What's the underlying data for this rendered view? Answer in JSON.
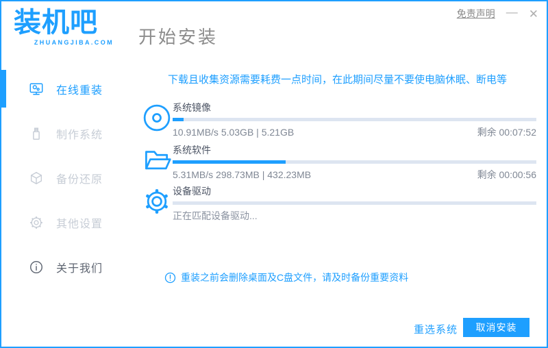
{
  "colors": {
    "primary": "#1E9FFF",
    "progress_track": "#dde5f1"
  },
  "titlebar": {
    "logo_text": "装机吧",
    "logo_subtext": "ZHUANGJIBA.COM",
    "page_title": "开始安装",
    "disclaimer_link": "免责声明",
    "minimize_glyph": "—",
    "close_glyph": "✕"
  },
  "sidebar": {
    "items": [
      {
        "label": "在线重装",
        "icon": "monitor-icon",
        "active": true
      },
      {
        "label": "制作系统",
        "icon": "usb-icon",
        "active": false
      },
      {
        "label": "备份还原",
        "icon": "backup-box-icon",
        "active": false
      },
      {
        "label": "其他设置",
        "icon": "gear-icon",
        "active": false
      },
      {
        "label": "关于我们",
        "icon": "info-icon",
        "active": false
      }
    ]
  },
  "main": {
    "notice": "下载且收集资源需要耗费一点时间，在此期间尽量不要使电脑休眠、断电等",
    "tasks": [
      {
        "name": "系统镜像",
        "icon": "disc-icon",
        "progress": 3,
        "stats": "10.91MB/s 5.03GB | 5.21GB",
        "remaining": "剩余 00:07:52"
      },
      {
        "name": "系统软件",
        "icon": "folder-icon",
        "progress": 31,
        "stats": "5.31MB/s 298.73MB | 432.23MB",
        "remaining": "剩余 00:00:56"
      },
      {
        "name": "设备驱动",
        "icon": "gear-icon",
        "progress": 0,
        "status": "正在匹配设备驱动..."
      }
    ],
    "warning_note": "重装之前会删除桌面及C盘文件，请及时备份重要资料"
  },
  "footer": {
    "reselect_label": "重选系统",
    "cancel_label": "取消安装"
  }
}
